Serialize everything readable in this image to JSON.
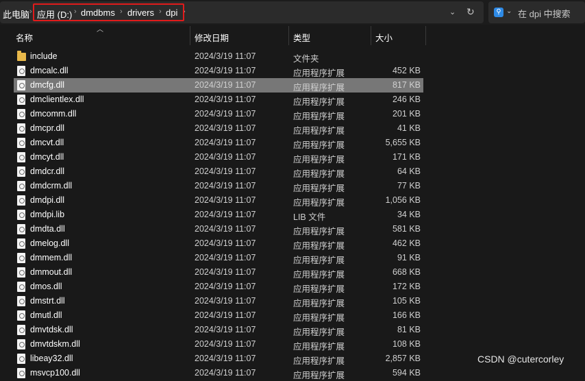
{
  "address_bar": {
    "root": "此电脑",
    "path": [
      "应用 (D:)",
      "dmdbms",
      "drivers",
      "dpi"
    ]
  },
  "search": {
    "placeholder": "在 dpi 中搜索"
  },
  "columns": {
    "name": "名称",
    "date": "修改日期",
    "type": "类型",
    "size": "大小"
  },
  "files": [
    {
      "name": "include",
      "date": "2024/3/19 11:07",
      "type": "文件夹",
      "size": "",
      "icon": "folder-icon"
    },
    {
      "name": "dmcalc.dll",
      "date": "2024/3/19 11:07",
      "type": "应用程序扩展",
      "size": "452 KB",
      "icon": "dll-file-icon"
    },
    {
      "name": "dmcfg.dll",
      "date": "2024/3/19 11:07",
      "type": "应用程序扩展",
      "size": "817 KB",
      "icon": "dll-file-icon",
      "selected": true
    },
    {
      "name": "dmclientlex.dll",
      "date": "2024/3/19 11:07",
      "type": "应用程序扩展",
      "size": "246 KB",
      "icon": "dll-file-icon"
    },
    {
      "name": "dmcomm.dll",
      "date": "2024/3/19 11:07",
      "type": "应用程序扩展",
      "size": "201 KB",
      "icon": "dll-file-icon"
    },
    {
      "name": "dmcpr.dll",
      "date": "2024/3/19 11:07",
      "type": "应用程序扩展",
      "size": "41 KB",
      "icon": "dll-file-icon"
    },
    {
      "name": "dmcvt.dll",
      "date": "2024/3/19 11:07",
      "type": "应用程序扩展",
      "size": "5,655 KB",
      "icon": "dll-file-icon"
    },
    {
      "name": "dmcyt.dll",
      "date": "2024/3/19 11:07",
      "type": "应用程序扩展",
      "size": "171 KB",
      "icon": "dll-file-icon"
    },
    {
      "name": "dmdcr.dll",
      "date": "2024/3/19 11:07",
      "type": "应用程序扩展",
      "size": "64 KB",
      "icon": "dll-file-icon"
    },
    {
      "name": "dmdcrm.dll",
      "date": "2024/3/19 11:07",
      "type": "应用程序扩展",
      "size": "77 KB",
      "icon": "dll-file-icon"
    },
    {
      "name": "dmdpi.dll",
      "date": "2024/3/19 11:07",
      "type": "应用程序扩展",
      "size": "1,056 KB",
      "icon": "dll-file-icon"
    },
    {
      "name": "dmdpi.lib",
      "date": "2024/3/19 11:07",
      "type": "LIB 文件",
      "size": "34 KB",
      "icon": "lib-file-icon"
    },
    {
      "name": "dmdta.dll",
      "date": "2024/3/19 11:07",
      "type": "应用程序扩展",
      "size": "581 KB",
      "icon": "dll-file-icon"
    },
    {
      "name": "dmelog.dll",
      "date": "2024/3/19 11:07",
      "type": "应用程序扩展",
      "size": "462 KB",
      "icon": "dll-file-icon"
    },
    {
      "name": "dmmem.dll",
      "date": "2024/3/19 11:07",
      "type": "应用程序扩展",
      "size": "91 KB",
      "icon": "dll-file-icon"
    },
    {
      "name": "dmmout.dll",
      "date": "2024/3/19 11:07",
      "type": "应用程序扩展",
      "size": "668 KB",
      "icon": "dll-file-icon"
    },
    {
      "name": "dmos.dll",
      "date": "2024/3/19 11:07",
      "type": "应用程序扩展",
      "size": "172 KB",
      "icon": "dll-file-icon"
    },
    {
      "name": "dmstrt.dll",
      "date": "2024/3/19 11:07",
      "type": "应用程序扩展",
      "size": "105 KB",
      "icon": "dll-file-icon"
    },
    {
      "name": "dmutl.dll",
      "date": "2024/3/19 11:07",
      "type": "应用程序扩展",
      "size": "166 KB",
      "icon": "dll-file-icon"
    },
    {
      "name": "dmvtdsk.dll",
      "date": "2024/3/19 11:07",
      "type": "应用程序扩展",
      "size": "81 KB",
      "icon": "dll-file-icon"
    },
    {
      "name": "dmvtdskm.dll",
      "date": "2024/3/19 11:07",
      "type": "应用程序扩展",
      "size": "108 KB",
      "icon": "dll-file-icon"
    },
    {
      "name": "libeay32.dll",
      "date": "2024/3/19 11:07",
      "type": "应用程序扩展",
      "size": "2,857 KB",
      "icon": "dll-file-icon"
    },
    {
      "name": "msvcp100.dll",
      "date": "2024/3/19 11:07",
      "type": "应用程序扩展",
      "size": "594 KB",
      "icon": "dll-file-icon"
    }
  ],
  "watermark": "CSDN @cutercorley",
  "colors": {
    "background": "#191919",
    "selection": "#777777",
    "highlight_box": "#e11b1b",
    "folder": "#e8b84a",
    "search_badge": "#2e8ae6"
  }
}
